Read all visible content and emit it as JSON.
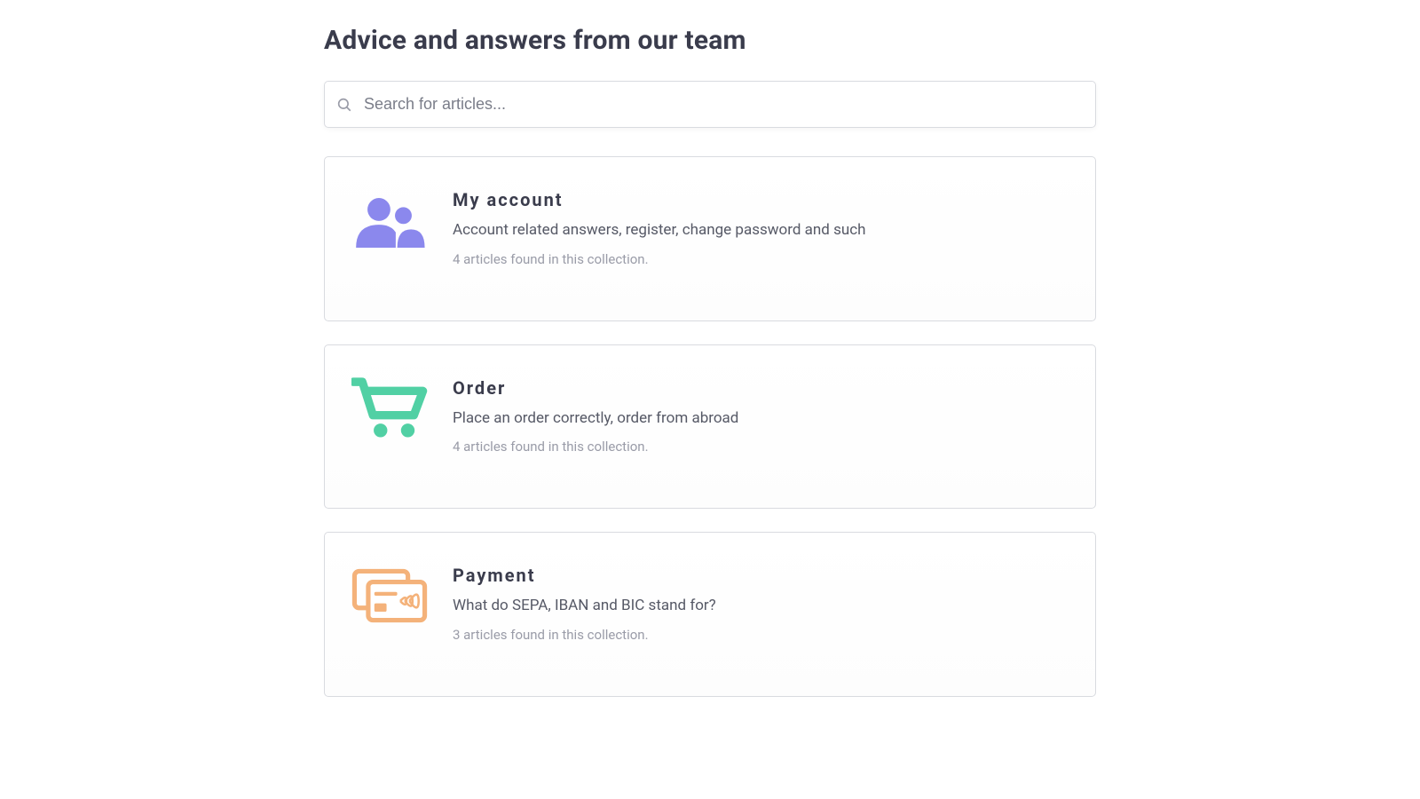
{
  "page": {
    "title": "Advice and answers from our team"
  },
  "search": {
    "placeholder": "Search for articles...",
    "value": ""
  },
  "collections": [
    {
      "id": "my-account",
      "icon": "users-icon",
      "icon_color": "#8b88ed",
      "title": "My account",
      "description": "Account related answers, register, change password and such",
      "meta": "4 articles found in this collection."
    },
    {
      "id": "order",
      "icon": "cart-icon",
      "icon_color": "#51d0a4",
      "title": "Order",
      "description": "Place an order correctly, order from abroad",
      "meta": "4 articles found in this collection."
    },
    {
      "id": "payment",
      "icon": "payment-icon",
      "icon_color": "#f4b27a",
      "title": "Payment",
      "description": "What do SEPA, IBAN and BIC stand for?",
      "meta": "3 articles found in this collection."
    }
  ]
}
